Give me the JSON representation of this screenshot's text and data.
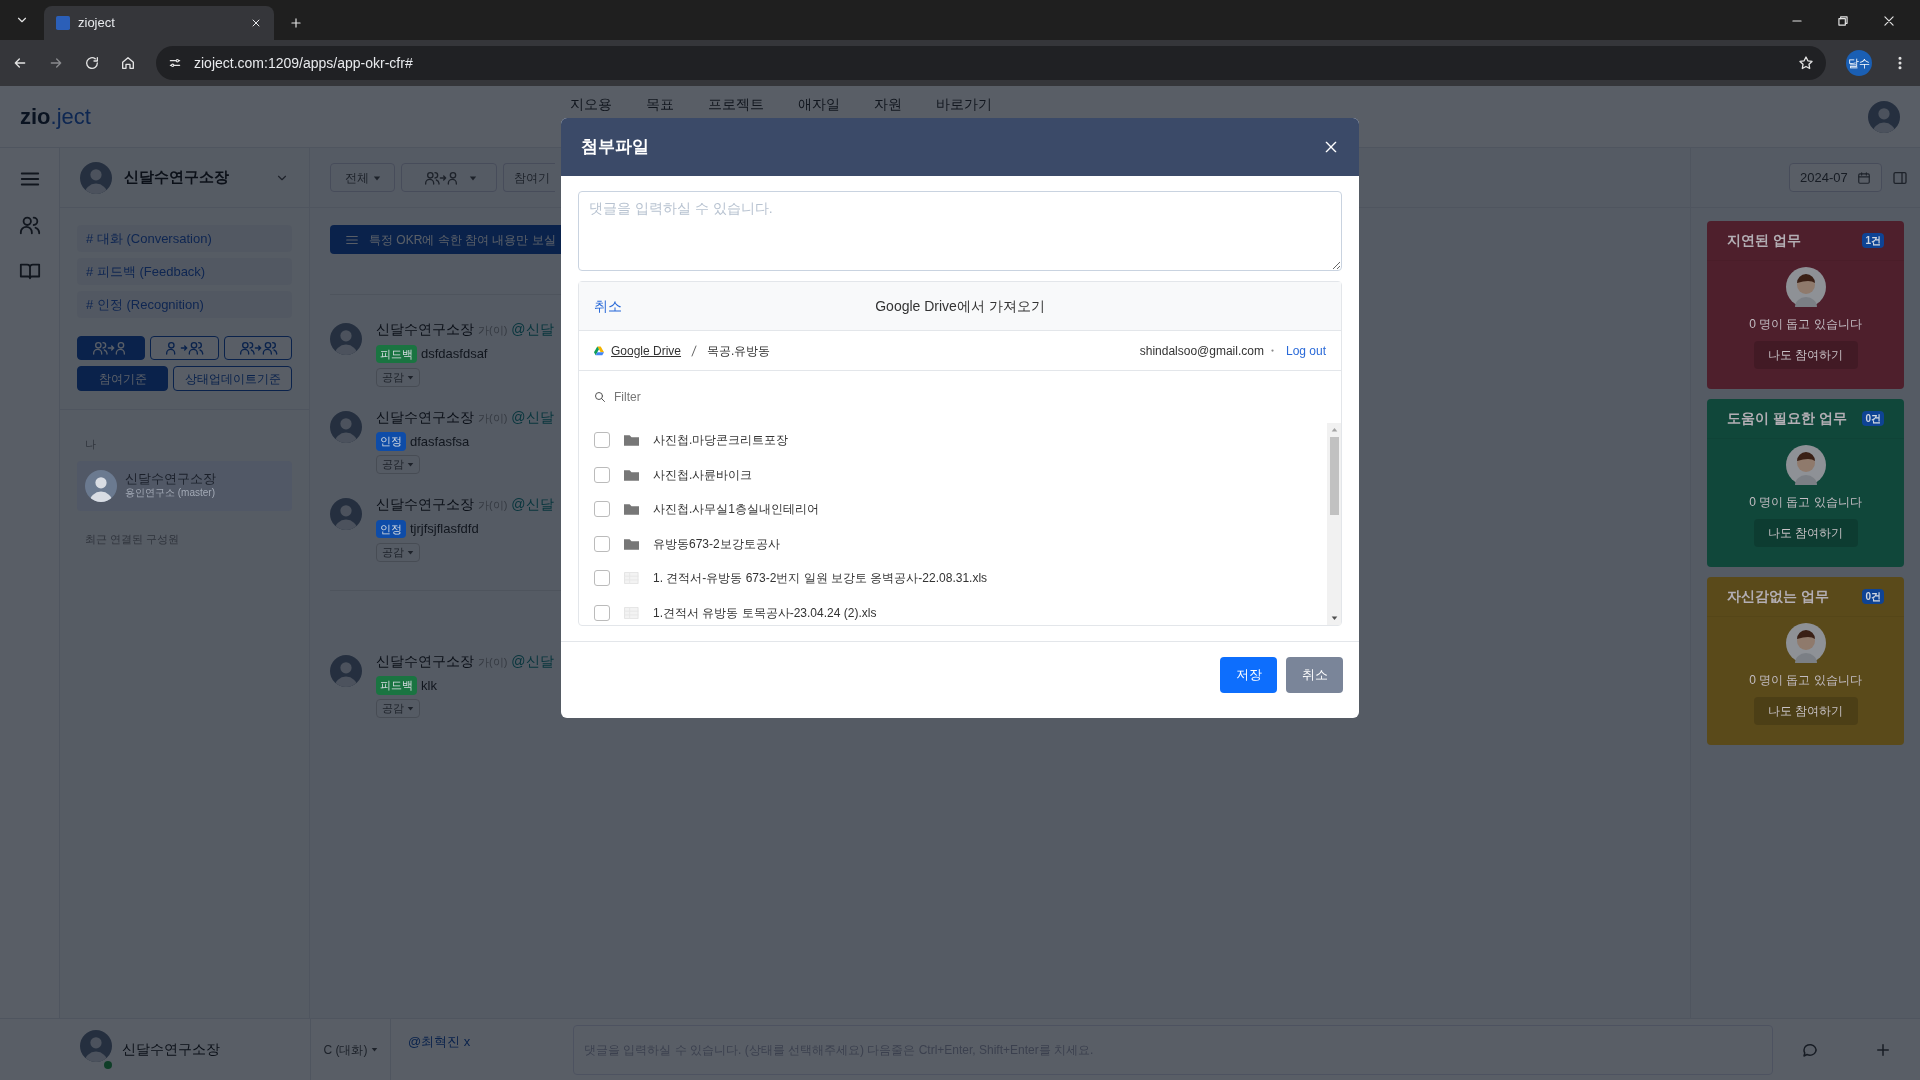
{
  "browser": {
    "tab_title": "zioject",
    "url": "zioject.com:1209/apps/app-okr-cfr#",
    "profile_label": "달수"
  },
  "header": {
    "logo_main": "zio",
    "logo_accent": ".ject",
    "nav": [
      "지오용",
      "목표",
      "프로젝트",
      "애자일",
      "자원",
      "바로가기"
    ]
  },
  "sidebar": {
    "user_name": "신달수연구소장",
    "channels": [
      "# 대화 (Conversation)",
      "# 피드백 (Feedback)",
      "# 인정 (Recognition)"
    ],
    "direction_buttons": [
      {
        "kind": "many_to_one",
        "selected": true
      },
      {
        "kind": "one_to_many",
        "selected": false
      },
      {
        "kind": "many_to_many",
        "selected": false
      }
    ],
    "basis_buttons": [
      {
        "label": "참여기준",
        "selected": true
      },
      {
        "label": "상태업데이트기준",
        "selected": false
      }
    ],
    "me_label": "나",
    "me_card": {
      "name": "신달수연구소장",
      "subtitle": "용인연구소 (master)"
    },
    "recent_label": "최근 연결된 구성원"
  },
  "toolbar": {
    "filter": "전체",
    "basis": "참여기"
  },
  "banner": "특정 OKR에 속한 참여 내용만 보실",
  "feed": [
    {
      "name": "신달수연구소장",
      "suffix": "가(이)",
      "mention": "@신달",
      "tag": "피드백",
      "color": "#1a7441",
      "text": "dsfdasfdsaf",
      "reaction": "공감"
    },
    {
      "name": "신달수연구소장",
      "suffix": "가(이)",
      "mention": "@신달",
      "tag": "인정",
      "color": "#0e4ca8",
      "text": "dfasfasfsa",
      "reaction": "공감"
    },
    {
      "name": "신달수연구소장",
      "suffix": "가(이)",
      "mention": "@신달",
      "tag": "인정",
      "color": "#0e4ca8",
      "text": "tjrjfsjflasfdfd",
      "reaction": "공감"
    },
    {
      "name": "신달수연구소장",
      "suffix": "가(이)",
      "mention": "@신달",
      "tag": "피드백",
      "color": "#1a7441",
      "text": "klk",
      "reaction": "공감"
    }
  ],
  "right_panel": {
    "date": "2024-07",
    "cards": [
      {
        "title": "지연된 업무",
        "count": "1건",
        "color": "#4e1f2c",
        "status": "0 명이 돕고 있습니다",
        "button": "나도 참여하기"
      },
      {
        "title": "도움이 필요한 업무",
        "count": "0건",
        "color": "#10473a",
        "status": "0 명이 돕고 있습니다",
        "button": "나도 참여하기"
      },
      {
        "title": "자신감없는 업무",
        "count": "0건",
        "color": "#5a4a1a",
        "status": "0 명이 돕고 있습니다",
        "button": "나도 참여하기"
      }
    ]
  },
  "bottom_bar": {
    "user_name": "신달수연구소장",
    "mode": "C (대화)",
    "mention": "@최혁진 x",
    "placeholder": "댓글을 입력하실 수 있습니다. (상태를 선택해주세요) 다음줄은 Ctrl+Enter, Shift+Enter를 치세요."
  },
  "modal": {
    "title": "첨부파일",
    "comment_placeholder": "댓글을 입력하실 수 있습니다.",
    "picker": {
      "cancel": "취소",
      "title": "Google Drive에서 가져오기",
      "breadcrumb": [
        "Google Drive",
        "목공.유방동"
      ],
      "account": "shindalsoo@gmail.com",
      "logout": "Log out",
      "filter_placeholder": "Filter",
      "items": [
        {
          "kind": "folder",
          "name": "사진첩.마당콘크리트포장",
          "checked": false
        },
        {
          "kind": "folder",
          "name": "사진첩.사륜바이크",
          "checked": false
        },
        {
          "kind": "folder",
          "name": "사진첩.사무실1층실내인테리어",
          "checked": false
        },
        {
          "kind": "folder",
          "name": "유방동673-2보강토공사",
          "checked": false
        },
        {
          "kind": "file",
          "name": "1. 견적서-유방동 673-2번지 일원 보강토 옹벽공사-22.08.31.xls",
          "checked": false
        },
        {
          "kind": "file",
          "name": "1.견적서 유방동 토목공사-23.04.24 (2).xls",
          "checked": false
        }
      ]
    },
    "save_button": "저장",
    "cancel_button": "취소"
  }
}
